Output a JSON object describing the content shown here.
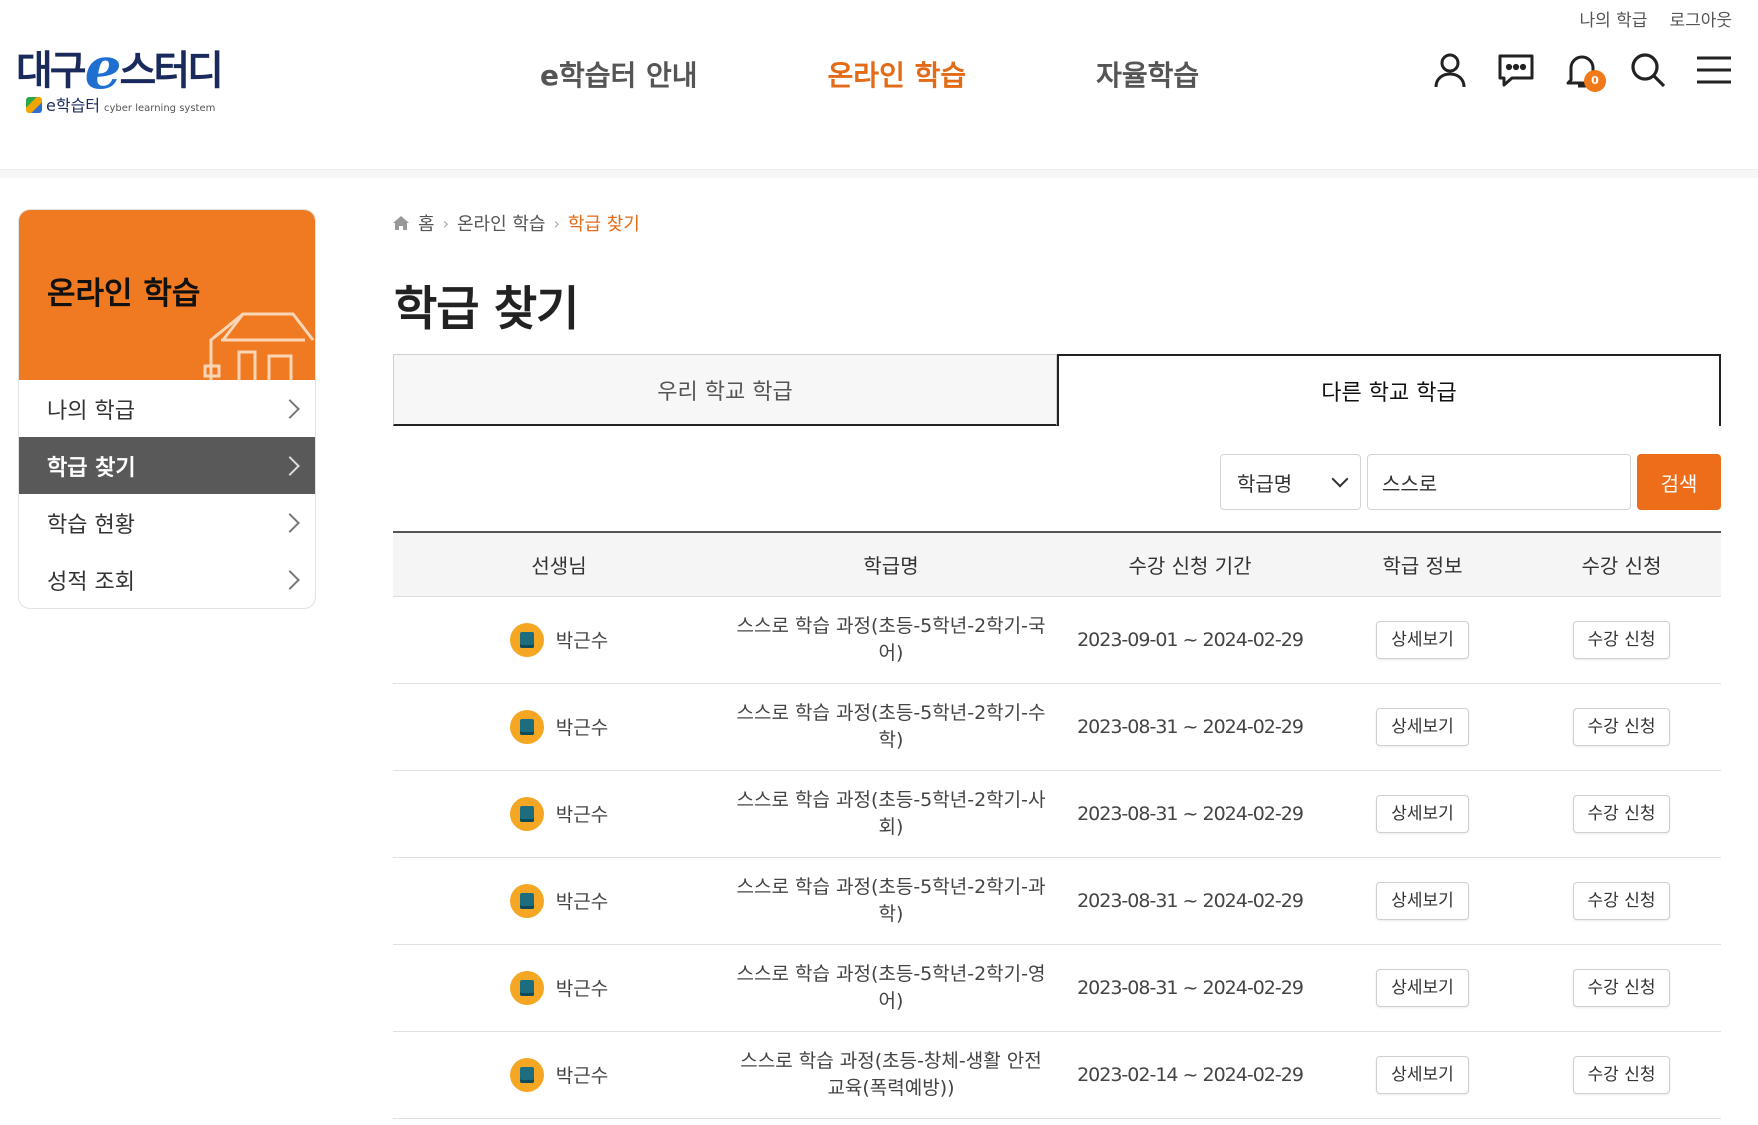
{
  "header": {
    "logo_main_left": "대구",
    "logo_main_e": "e",
    "logo_main_right": "스터디",
    "logo_sub": "e학습터",
    "logo_sub_small": "cyber learning system",
    "util_links": [
      "나의 학급",
      "로그아웃"
    ],
    "nav": [
      {
        "label": "e학습터 안내",
        "active": false
      },
      {
        "label": "온라인 학습",
        "active": true
      },
      {
        "label": "자율학습",
        "active": false
      }
    ],
    "icons": [
      "user-icon",
      "chat-icon",
      "bell-icon",
      "search-icon",
      "menu-icon"
    ],
    "notification_count": "0",
    "accent_color": "#e36a17"
  },
  "sidebar": {
    "title": "온라인 학습",
    "items": [
      {
        "label": "나의 학급",
        "active": false
      },
      {
        "label": "학급 찾기",
        "active": true
      },
      {
        "label": "학습 현황",
        "active": false
      },
      {
        "label": "성적 조회",
        "active": false
      }
    ]
  },
  "breadcrumb": [
    "홈",
    "온라인 학습",
    "학급 찾기"
  ],
  "page_title": "학급 찾기",
  "tabs": [
    {
      "label": "우리 학교 학급",
      "active": false
    },
    {
      "label": "다른 학교 학급",
      "active": true
    }
  ],
  "search": {
    "select_value": "학급명",
    "input_value": "스스로",
    "button_label": "검색"
  },
  "table": {
    "headers": [
      "선생님",
      "학급명",
      "수강 신청 기간",
      "학급 정보",
      "수강 신청"
    ],
    "detail_label": "상세보기",
    "enroll_label": "수강 신청",
    "rows": [
      {
        "teacher": "박근수",
        "class_name": "스스로 학습 과정(초등-5학년-2학기-국어)",
        "period": "2023-09-01 ~ 2024-02-29"
      },
      {
        "teacher": "박근수",
        "class_name": "스스로 학습 과정(초등-5학년-2학기-수학)",
        "period": "2023-08-31 ~ 2024-02-29"
      },
      {
        "teacher": "박근수",
        "class_name": "스스로 학습 과정(초등-5학년-2학기-사회)",
        "period": "2023-08-31 ~ 2024-02-29"
      },
      {
        "teacher": "박근수",
        "class_name": "스스로 학습 과정(초등-5학년-2학기-과학)",
        "period": "2023-08-31 ~ 2024-02-29"
      },
      {
        "teacher": "박근수",
        "class_name": "스스로 학습 과정(초등-5학년-2학기-영어)",
        "period": "2023-08-31 ~ 2024-02-29"
      },
      {
        "teacher": "박근수",
        "class_name": "스스로 학습 과정(초등-창체-생활 안전교육(폭력예방))",
        "period": "2023-02-14 ~ 2024-02-29"
      }
    ]
  }
}
